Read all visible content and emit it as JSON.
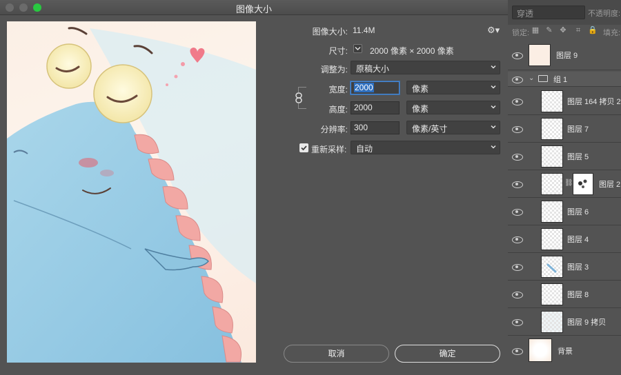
{
  "dialog": {
    "title": "图像大小",
    "image_size_label": "图像大小:",
    "image_size_value": "11.4M",
    "dimensions_label": "尺寸:",
    "dimensions_value": "2000 像素  ×  2000 像素",
    "fit_to_label": "调整为:",
    "fit_to_value": "原稿大小",
    "width_label": "宽度:",
    "width_value": "2000",
    "width_unit": "像素",
    "height_label": "高度:",
    "height_value": "2000",
    "height_unit": "像素",
    "resolution_label": "分辨率:",
    "resolution_value": "300",
    "resolution_unit": "像素/英寸",
    "resample_label": "重新采样:",
    "resample_value": "自动",
    "cancel_label": "取消",
    "ok_label": "确定"
  },
  "layers_panel": {
    "blend_mode": "穿透",
    "opacity_label": "不透明度:",
    "lock_label": "锁定:",
    "fill_label": "填充:",
    "layers": [
      {
        "name": "图层 9"
      },
      {
        "name": "组 1"
      },
      {
        "name": "图层 164 拷贝 2"
      },
      {
        "name": "图层 7"
      },
      {
        "name": "图层 5"
      },
      {
        "name": "图层 2"
      },
      {
        "name": "图层 6"
      },
      {
        "name": "图层 4"
      },
      {
        "name": "图层 3"
      },
      {
        "name": "图层 8"
      },
      {
        "name": "图层 9 拷贝"
      },
      {
        "name": "背景"
      }
    ]
  }
}
